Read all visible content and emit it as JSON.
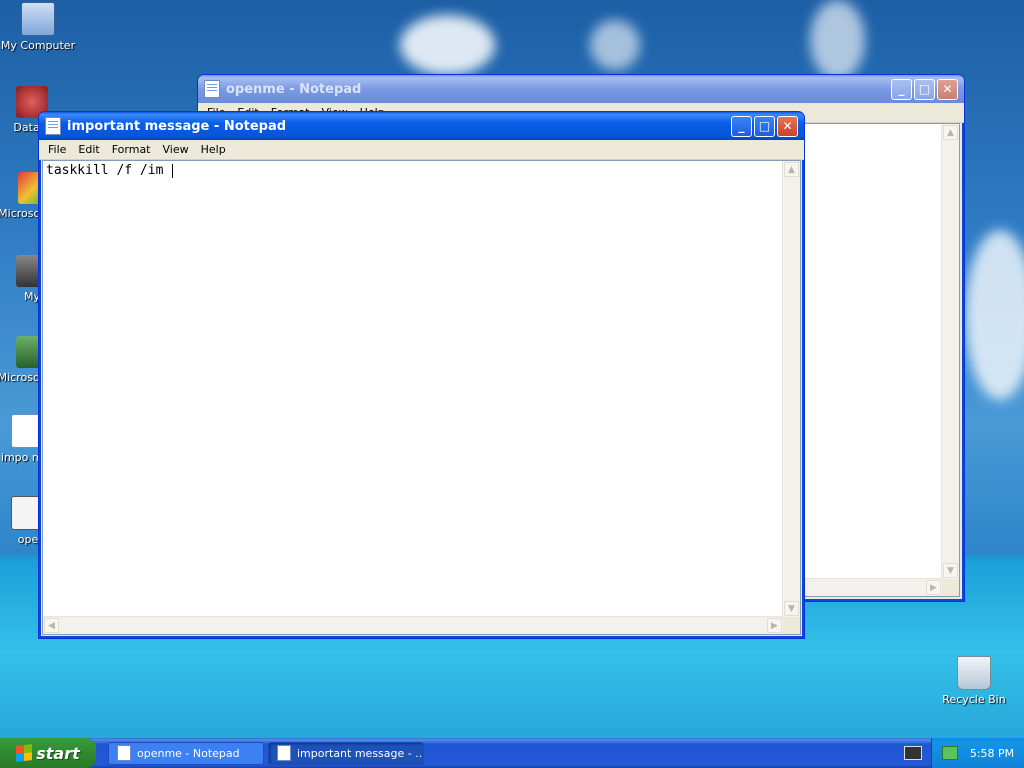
{
  "desktop": {
    "icons": [
      {
        "label": "My Computer"
      },
      {
        "label": "DataW"
      },
      {
        "label": "Microso C++"
      },
      {
        "label": "My"
      },
      {
        "label": "Microso Basi"
      },
      {
        "label": "impo mes"
      },
      {
        "label": "ope"
      }
    ],
    "recycle_bin_label": "Recycle Bin"
  },
  "back_window": {
    "title": "openme - Notepad",
    "menu": [
      "File",
      "Edit",
      "Format",
      "View",
      "Help"
    ]
  },
  "front_window": {
    "title": "important message - Notepad",
    "menu": [
      "File",
      "Edit",
      "Format",
      "View",
      "Help"
    ],
    "content": "taskkill /f /im "
  },
  "taskbar": {
    "start_label": "start",
    "tasks": [
      {
        "label": "openme - Notepad"
      },
      {
        "label": "important message - ..."
      }
    ],
    "clock": "5:58 PM"
  }
}
